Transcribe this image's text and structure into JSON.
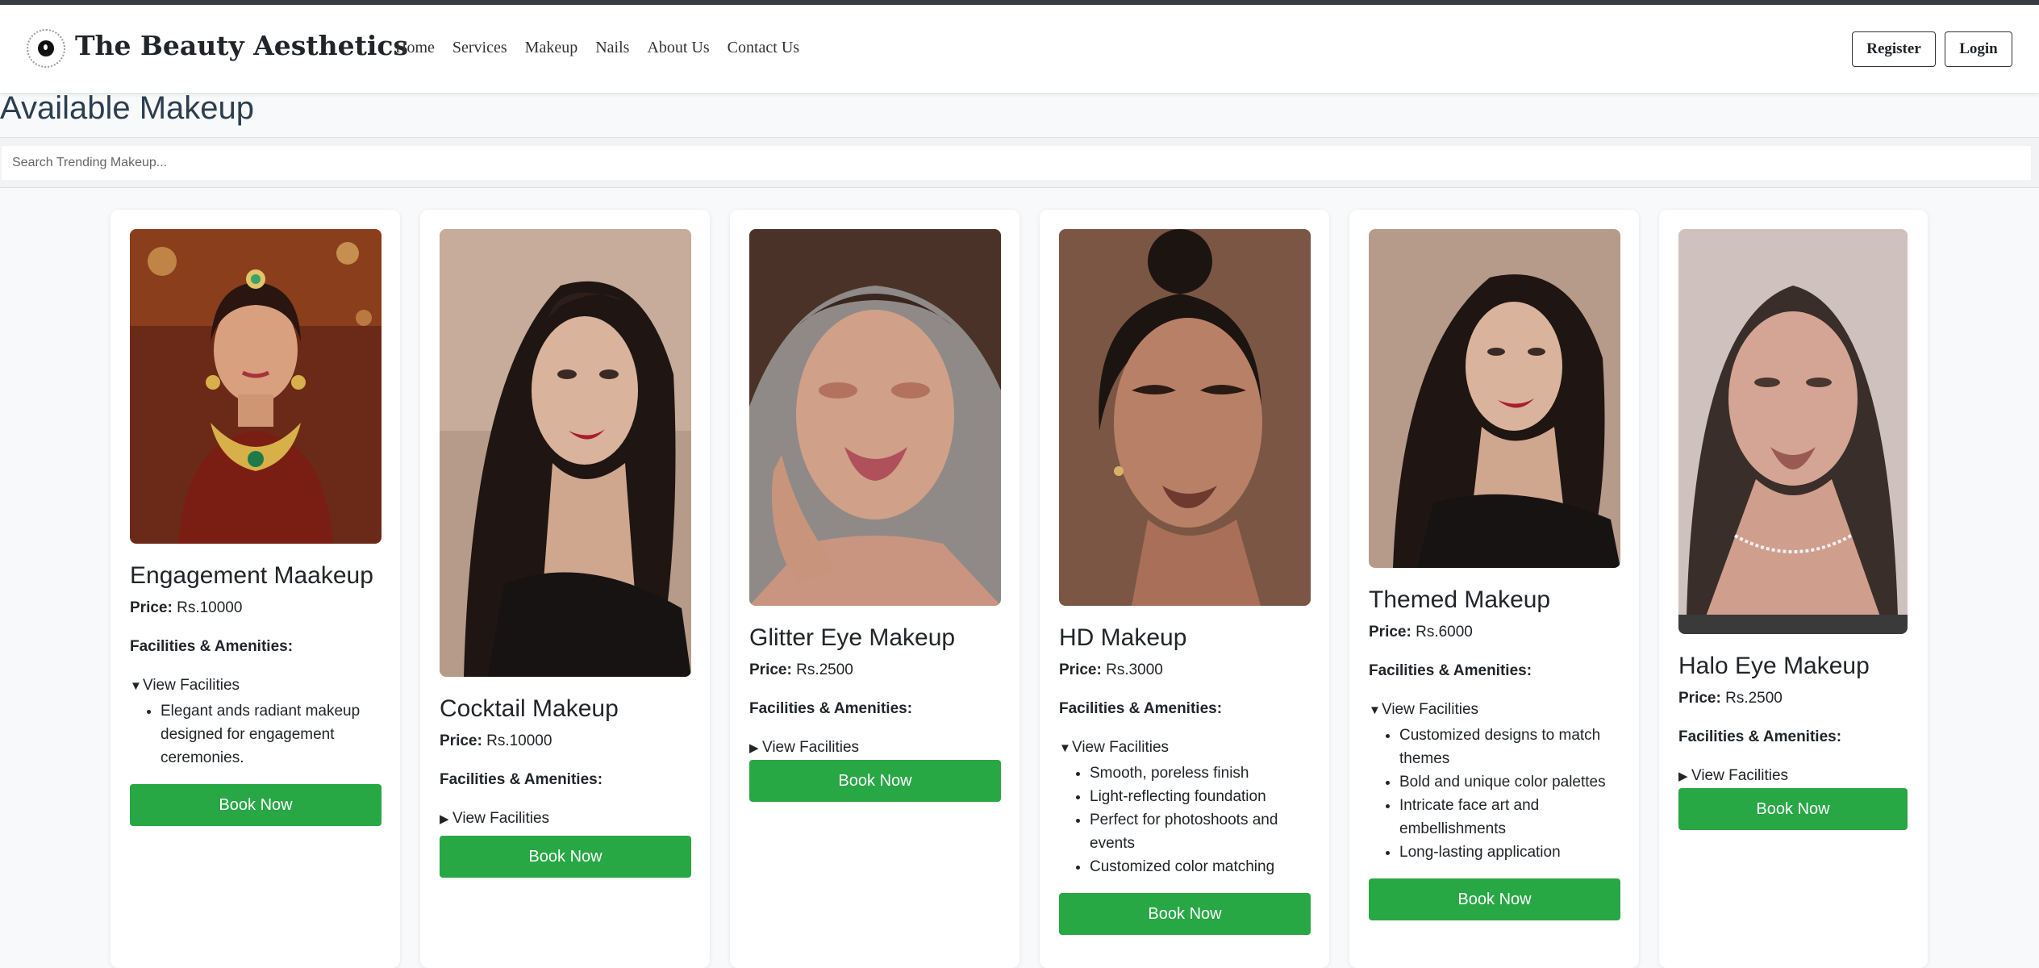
{
  "header": {
    "brand": "The Beauty Aesthetics",
    "nav": [
      "Home",
      "Services",
      "Makeup",
      "Nails",
      "About Us",
      "Contact Us"
    ],
    "register_label": "Register",
    "login_label": "Login"
  },
  "page": {
    "title": "Available Makeup",
    "search_placeholder": "Search Trending Makeup..."
  },
  "labels": {
    "price": "Price:",
    "facilities": "Facilities & Amenities:",
    "view_facilities": "View Facilities",
    "book": "Book Now"
  },
  "cards": [
    {
      "title": "Engagement Maakeup",
      "price": "Rs.10000",
      "open": true,
      "facilities": [
        "Elegant ands radiant makeup designed for engagement ceremonies."
      ]
    },
    {
      "title": "Cocktail Makeup",
      "price": "Rs.10000",
      "open": false,
      "facilities": []
    },
    {
      "title": "Glitter Eye Makeup",
      "price": "Rs.2500",
      "open": false,
      "facilities": []
    },
    {
      "title": "HD Makeup",
      "price": "Rs.3000",
      "open": true,
      "facilities": [
        "Smooth, poreless finish",
        "Light-reflecting foundation",
        "Perfect for photoshoots and events",
        "Customized color matching"
      ]
    },
    {
      "title": "Themed Makeup",
      "price": "Rs.6000",
      "open": true,
      "facilities": [
        "Customized designs to match themes",
        "Bold and unique color palettes",
        "Intricate face art and embellishments",
        "Long-lasting application"
      ]
    },
    {
      "title": "Halo Eye Makeup",
      "price": "Rs.2500",
      "open": false,
      "facilities": []
    }
  ],
  "colors": {
    "accent_green": "#28a745",
    "title_blue": "#2c3e50"
  }
}
